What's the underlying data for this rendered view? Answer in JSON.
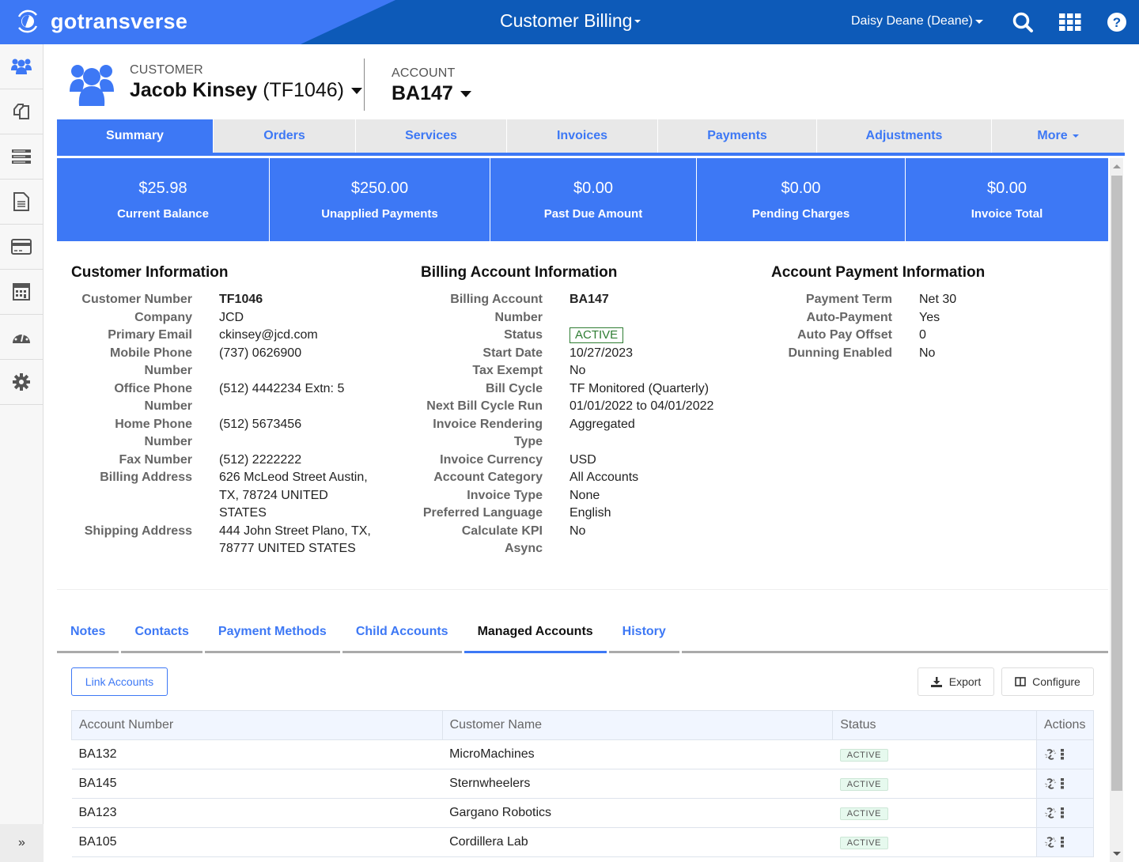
{
  "topbar": {
    "logo_text": "gotransverse",
    "app_title": "Customer Billing",
    "user": "Daisy Deane (Deane)",
    "icons": [
      "search-icon",
      "apps-grid-icon",
      "help-icon"
    ]
  },
  "sidebar": {
    "items": [
      {
        "icon": "customers-icon",
        "active": true
      },
      {
        "icon": "documents-icon"
      },
      {
        "icon": "server-list-icon"
      },
      {
        "icon": "file-icon"
      },
      {
        "icon": "credit-card-icon"
      },
      {
        "icon": "calculator-icon"
      },
      {
        "icon": "dashboard-gauge-icon"
      },
      {
        "icon": "gear-icon"
      }
    ],
    "expand_label": "»"
  },
  "header": {
    "customer_label": "CUSTOMER",
    "customer_name": "Jacob Kinsey",
    "customer_id": "(TF1046)",
    "account_label": "ACCOUNT",
    "account_id": "BA147"
  },
  "tabs": [
    {
      "label": "Summary",
      "active": true
    },
    {
      "label": "Orders"
    },
    {
      "label": "Services"
    },
    {
      "label": "Invoices"
    },
    {
      "label": "Payments"
    },
    {
      "label": "Adjustments"
    },
    {
      "label": "More"
    }
  ],
  "kpis": [
    {
      "value": "$25.98",
      "label": "Current Balance"
    },
    {
      "value": "$250.00",
      "label": "Unapplied Payments"
    },
    {
      "value": "$0.00",
      "label": "Past Due Amount"
    },
    {
      "value": "$0.00",
      "label": "Pending Charges"
    },
    {
      "value": "$0.00",
      "label": "Invoice Total"
    }
  ],
  "customer_info": {
    "title": "Customer Information",
    "rows": [
      {
        "k": "Customer Number",
        "v": "TF1046"
      },
      {
        "k": "Company",
        "v": "JCD"
      },
      {
        "k": "Primary Email",
        "v": "ckinsey@jcd.com"
      },
      {
        "k": "Mobile Phone Number",
        "v": "(737) 0626900"
      },
      {
        "k": "Office Phone Number",
        "v": "(512) 4442234 Extn: 5"
      },
      {
        "k": "Home Phone Number",
        "v": "(512) 5673456"
      },
      {
        "k": "Fax Number",
        "v": "(512) 2222222"
      },
      {
        "k": "Billing Address",
        "v": "626 McLeod Street Austin, TX, 78724 UNITED STATES"
      },
      {
        "k": "Shipping Address",
        "v": "444 John Street Plano, TX, 78777 UNITED STATES"
      }
    ]
  },
  "billing_info": {
    "title": "Billing Account Information",
    "rows": [
      {
        "k": "Billing Account Number",
        "v": "BA147"
      },
      {
        "k": "Status",
        "v": "ACTIVE"
      },
      {
        "k": "Start Date",
        "v": "10/27/2023"
      },
      {
        "k": "Tax Exempt",
        "v": "No"
      },
      {
        "k": "Bill Cycle",
        "v": "TF Monitored (Quarterly)"
      },
      {
        "k": "Next Bill Cycle Run",
        "v": "01/01/2022 to 04/01/2022"
      },
      {
        "k": "Invoice Rendering Type",
        "v": "Aggregated"
      },
      {
        "k": "Invoice Currency",
        "v": "USD"
      },
      {
        "k": "Account Category",
        "v": "All Accounts"
      },
      {
        "k": "Invoice Type",
        "v": "None"
      },
      {
        "k": "Preferred Language",
        "v": "English"
      },
      {
        "k": "Calculate KPI Async",
        "v": "No"
      }
    ]
  },
  "payment_info": {
    "title": "Account Payment Information",
    "rows": [
      {
        "k": "Payment Term",
        "v": "Net 30"
      },
      {
        "k": "Auto-Payment",
        "v": "Yes"
      },
      {
        "k": "Auto Pay Offset",
        "v": "0"
      },
      {
        "k": "Dunning Enabled",
        "v": "No"
      }
    ]
  },
  "subtabs": [
    {
      "label": "Notes"
    },
    {
      "label": "Contacts"
    },
    {
      "label": "Payment Methods"
    },
    {
      "label": "Child Accounts"
    },
    {
      "label": "Managed Accounts",
      "active": true
    },
    {
      "label": "History"
    }
  ],
  "actions": {
    "link_accounts": "Link Accounts",
    "export": "Export",
    "configure": "Configure"
  },
  "table": {
    "columns": [
      "Account Number",
      "Customer Name",
      "Status",
      "Actions"
    ],
    "rows": [
      {
        "account": "BA132",
        "customer": "MicroMachines",
        "status": "ACTIVE"
      },
      {
        "account": "BA145",
        "customer": "Sternwheelers",
        "status": "ACTIVE"
      },
      {
        "account": "BA123",
        "customer": "Gargano Robotics",
        "status": "ACTIVE"
      },
      {
        "account": "BA105",
        "customer": "Cordillera Lab",
        "status": "ACTIVE"
      }
    ]
  }
}
